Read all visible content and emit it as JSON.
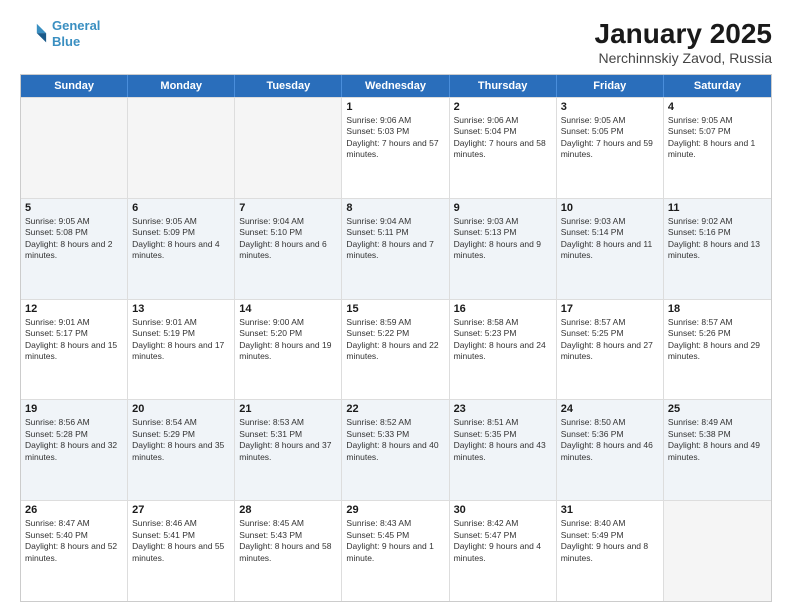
{
  "logo": {
    "line1": "General",
    "line2": "Blue"
  },
  "title": "January 2025",
  "subtitle": "Nerchinnskiy Zavod, Russia",
  "header": {
    "days": [
      "Sunday",
      "Monday",
      "Tuesday",
      "Wednesday",
      "Thursday",
      "Friday",
      "Saturday"
    ]
  },
  "weeks": [
    [
      {
        "day": "",
        "empty": true
      },
      {
        "day": "",
        "empty": true
      },
      {
        "day": "",
        "empty": true
      },
      {
        "day": "1",
        "sunrise": "9:06 AM",
        "sunset": "5:03 PM",
        "daylight": "7 hours and 57 minutes."
      },
      {
        "day": "2",
        "sunrise": "9:06 AM",
        "sunset": "5:04 PM",
        "daylight": "7 hours and 58 minutes."
      },
      {
        "day": "3",
        "sunrise": "9:05 AM",
        "sunset": "5:05 PM",
        "daylight": "7 hours and 59 minutes."
      },
      {
        "day": "4",
        "sunrise": "9:05 AM",
        "sunset": "5:07 PM",
        "daylight": "8 hours and 1 minute."
      }
    ],
    [
      {
        "day": "5",
        "sunrise": "9:05 AM",
        "sunset": "5:08 PM",
        "daylight": "8 hours and 2 minutes."
      },
      {
        "day": "6",
        "sunrise": "9:05 AM",
        "sunset": "5:09 PM",
        "daylight": "8 hours and 4 minutes."
      },
      {
        "day": "7",
        "sunrise": "9:04 AM",
        "sunset": "5:10 PM",
        "daylight": "8 hours and 6 minutes."
      },
      {
        "day": "8",
        "sunrise": "9:04 AM",
        "sunset": "5:11 PM",
        "daylight": "8 hours and 7 minutes."
      },
      {
        "day": "9",
        "sunrise": "9:03 AM",
        "sunset": "5:13 PM",
        "daylight": "8 hours and 9 minutes."
      },
      {
        "day": "10",
        "sunrise": "9:03 AM",
        "sunset": "5:14 PM",
        "daylight": "8 hours and 11 minutes."
      },
      {
        "day": "11",
        "sunrise": "9:02 AM",
        "sunset": "5:16 PM",
        "daylight": "8 hours and 13 minutes."
      }
    ],
    [
      {
        "day": "12",
        "sunrise": "9:01 AM",
        "sunset": "5:17 PM",
        "daylight": "8 hours and 15 minutes."
      },
      {
        "day": "13",
        "sunrise": "9:01 AM",
        "sunset": "5:19 PM",
        "daylight": "8 hours and 17 minutes."
      },
      {
        "day": "14",
        "sunrise": "9:00 AM",
        "sunset": "5:20 PM",
        "daylight": "8 hours and 19 minutes."
      },
      {
        "day": "15",
        "sunrise": "8:59 AM",
        "sunset": "5:22 PM",
        "daylight": "8 hours and 22 minutes."
      },
      {
        "day": "16",
        "sunrise": "8:58 AM",
        "sunset": "5:23 PM",
        "daylight": "8 hours and 24 minutes."
      },
      {
        "day": "17",
        "sunrise": "8:57 AM",
        "sunset": "5:25 PM",
        "daylight": "8 hours and 27 minutes."
      },
      {
        "day": "18",
        "sunrise": "8:57 AM",
        "sunset": "5:26 PM",
        "daylight": "8 hours and 29 minutes."
      }
    ],
    [
      {
        "day": "19",
        "sunrise": "8:56 AM",
        "sunset": "5:28 PM",
        "daylight": "8 hours and 32 minutes."
      },
      {
        "day": "20",
        "sunrise": "8:54 AM",
        "sunset": "5:29 PM",
        "daylight": "8 hours and 35 minutes."
      },
      {
        "day": "21",
        "sunrise": "8:53 AM",
        "sunset": "5:31 PM",
        "daylight": "8 hours and 37 minutes."
      },
      {
        "day": "22",
        "sunrise": "8:52 AM",
        "sunset": "5:33 PM",
        "daylight": "8 hours and 40 minutes."
      },
      {
        "day": "23",
        "sunrise": "8:51 AM",
        "sunset": "5:35 PM",
        "daylight": "8 hours and 43 minutes."
      },
      {
        "day": "24",
        "sunrise": "8:50 AM",
        "sunset": "5:36 PM",
        "daylight": "8 hours and 46 minutes."
      },
      {
        "day": "25",
        "sunrise": "8:49 AM",
        "sunset": "5:38 PM",
        "daylight": "8 hours and 49 minutes."
      }
    ],
    [
      {
        "day": "26",
        "sunrise": "8:47 AM",
        "sunset": "5:40 PM",
        "daylight": "8 hours and 52 minutes."
      },
      {
        "day": "27",
        "sunrise": "8:46 AM",
        "sunset": "5:41 PM",
        "daylight": "8 hours and 55 minutes."
      },
      {
        "day": "28",
        "sunrise": "8:45 AM",
        "sunset": "5:43 PM",
        "daylight": "8 hours and 58 minutes."
      },
      {
        "day": "29",
        "sunrise": "8:43 AM",
        "sunset": "5:45 PM",
        "daylight": "9 hours and 1 minute."
      },
      {
        "day": "30",
        "sunrise": "8:42 AM",
        "sunset": "5:47 PM",
        "daylight": "9 hours and 4 minutes."
      },
      {
        "day": "31",
        "sunrise": "8:40 AM",
        "sunset": "5:49 PM",
        "daylight": "9 hours and 8 minutes."
      },
      {
        "day": "",
        "empty": true
      }
    ]
  ]
}
